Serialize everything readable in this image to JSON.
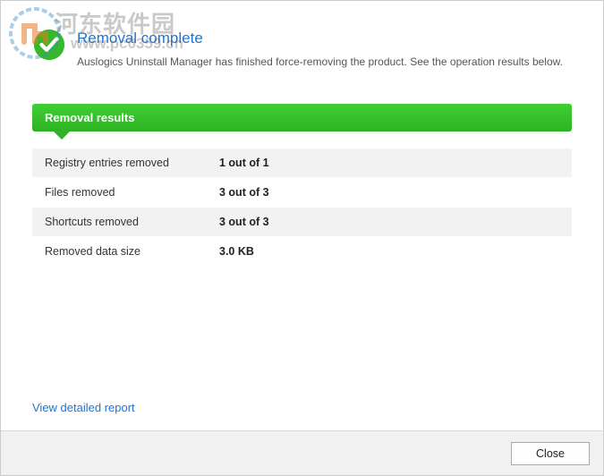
{
  "watermark": {
    "text_cn": "河东软件园",
    "text_url": "www.pc0359.cn"
  },
  "header": {
    "title": "Removal complete",
    "subtitle": "Auslogics Uninstall Manager has finished force-removing the product. See the operation results below."
  },
  "section": {
    "title": "Removal results"
  },
  "results": [
    {
      "label": "Registry entries removed",
      "value": "1 out of 1"
    },
    {
      "label": "Files removed",
      "value": "3 out of 3"
    },
    {
      "label": "Shortcuts removed",
      "value": "3 out of 3"
    },
    {
      "label": "Removed data size",
      "value": "3.0 KB"
    }
  ],
  "links": {
    "detailed_report": "View detailed report"
  },
  "buttons": {
    "close": "Close"
  }
}
